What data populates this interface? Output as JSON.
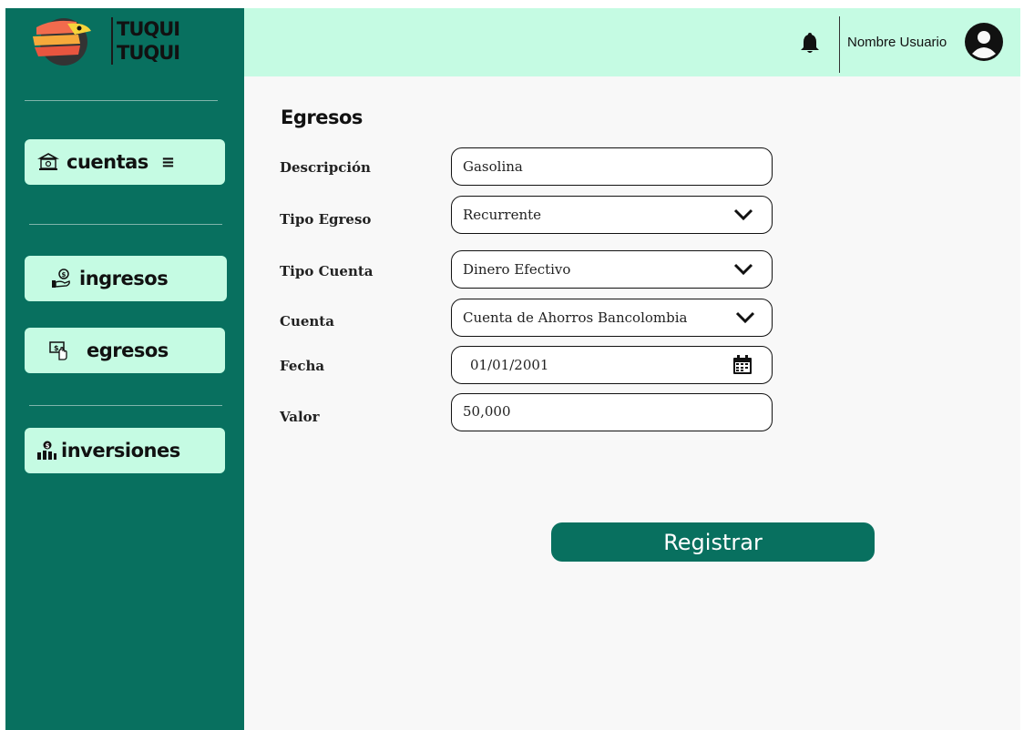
{
  "brand": {
    "line1": "TUQUI",
    "line2": "TUQUI"
  },
  "sidebar": {
    "items": [
      {
        "label": "cuentas",
        "icon": "bank-icon",
        "menu_glyph": "≡"
      },
      {
        "label": "ingresos",
        "icon": "hand-coin-icon"
      },
      {
        "label": "egresos",
        "icon": "cash-hand-icon"
      },
      {
        "label": "inversiones",
        "icon": "investment-icon"
      }
    ]
  },
  "header": {
    "username": "Nombre Usuario",
    "icons": [
      "bell-icon",
      "user-avatar-icon"
    ]
  },
  "form": {
    "title": "Egresos",
    "fields": [
      {
        "label": "Descripción",
        "value": "Gasolina",
        "type": "text"
      },
      {
        "label": "Tipo Egreso",
        "value": "Recurrente",
        "type": "select"
      },
      {
        "label": "Tipo Cuenta",
        "value": "Dinero Efectivo",
        "type": "select"
      },
      {
        "label": "Cuenta",
        "value": "Cuenta de Ahorros Bancolombia",
        "type": "select"
      },
      {
        "label": "Fecha",
        "value": "01/01/2001",
        "type": "date"
      },
      {
        "label": "Valor",
        "value": "50,000",
        "type": "text"
      }
    ],
    "submit_label": "Registrar"
  },
  "colors": {
    "sidebar": "#08705f",
    "accent_light": "#c5fbe3",
    "background": "#f8f8f8"
  }
}
